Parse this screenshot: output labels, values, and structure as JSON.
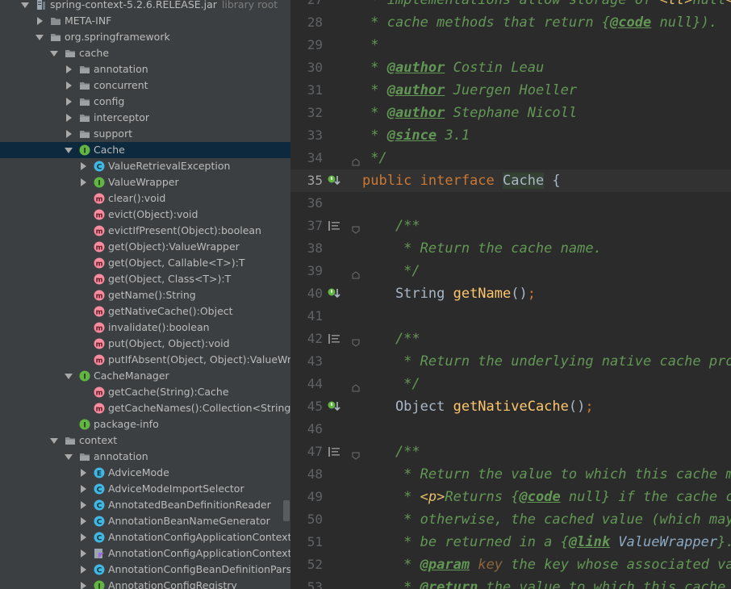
{
  "tree": {
    "rows": [
      {
        "label": "spring-context-5.2.6.RELEASE.jar",
        "hint": "library root",
        "depth": 0,
        "arrow": "open",
        "icon": "jar-icon"
      },
      {
        "label": "META-INF",
        "depth": 1,
        "arrow": "closed",
        "icon": "folder-icon"
      },
      {
        "label": "org.springframework",
        "depth": 1,
        "arrow": "open",
        "icon": "package-icon"
      },
      {
        "label": "cache",
        "depth": 2,
        "arrow": "open",
        "icon": "package-icon"
      },
      {
        "label": "annotation",
        "depth": 3,
        "arrow": "closed",
        "icon": "package-icon"
      },
      {
        "label": "concurrent",
        "depth": 3,
        "arrow": "closed",
        "icon": "package-icon"
      },
      {
        "label": "config",
        "depth": 3,
        "arrow": "closed",
        "icon": "package-icon"
      },
      {
        "label": "interceptor",
        "depth": 3,
        "arrow": "closed",
        "icon": "package-icon"
      },
      {
        "label": "support",
        "depth": 3,
        "arrow": "closed",
        "icon": "package-icon"
      },
      {
        "label": "Cache",
        "depth": 3,
        "arrow": "open",
        "icon": "interface-icon",
        "selected": true
      },
      {
        "label": "ValueRetrievalException",
        "depth": 4,
        "arrow": "closed",
        "icon": "class-icon"
      },
      {
        "label": "ValueWrapper",
        "depth": 4,
        "arrow": "closed",
        "icon": "interface-icon"
      },
      {
        "label": "clear():void",
        "depth": 4,
        "arrow": "none",
        "icon": "method-icon"
      },
      {
        "label": "evict(Object):void",
        "depth": 4,
        "arrow": "none",
        "icon": "method-icon"
      },
      {
        "label": "evictIfPresent(Object):boolean",
        "depth": 4,
        "arrow": "none",
        "icon": "method-icon"
      },
      {
        "label": "get(Object):ValueWrapper",
        "depth": 4,
        "arrow": "none",
        "icon": "method-icon"
      },
      {
        "label": "get(Object, Callable<T>):T",
        "depth": 4,
        "arrow": "none",
        "icon": "method-icon"
      },
      {
        "label": "get(Object, Class<T>):T",
        "depth": 4,
        "arrow": "none",
        "icon": "method-icon"
      },
      {
        "label": "getName():String",
        "depth": 4,
        "arrow": "none",
        "icon": "method-icon"
      },
      {
        "label": "getNativeCache():Object",
        "depth": 4,
        "arrow": "none",
        "icon": "method-icon"
      },
      {
        "label": "invalidate():boolean",
        "depth": 4,
        "arrow": "none",
        "icon": "method-icon"
      },
      {
        "label": "put(Object, Object):void",
        "depth": 4,
        "arrow": "none",
        "icon": "method-icon"
      },
      {
        "label": "putIfAbsent(Object, Object):ValueWrapper",
        "depth": 4,
        "arrow": "none",
        "icon": "method-icon"
      },
      {
        "label": "CacheManager",
        "depth": 3,
        "arrow": "open",
        "icon": "interface-icon"
      },
      {
        "label": "getCache(String):Cache",
        "depth": 4,
        "arrow": "none",
        "icon": "method-icon"
      },
      {
        "label": "getCacheNames():Collection<String>",
        "depth": 4,
        "arrow": "none",
        "icon": "method-icon"
      },
      {
        "label": "package-info",
        "depth": 3,
        "arrow": "none",
        "icon": "interface-icon"
      },
      {
        "label": "context",
        "depth": 2,
        "arrow": "open",
        "icon": "package-icon"
      },
      {
        "label": "annotation",
        "depth": 3,
        "arrow": "open",
        "icon": "package-icon"
      },
      {
        "label": "AdviceMode",
        "depth": 4,
        "arrow": "closed",
        "icon": "enum-icon"
      },
      {
        "label": "AdviceModeImportSelector",
        "depth": 4,
        "arrow": "closed",
        "icon": "class-icon"
      },
      {
        "label": "AnnotatedBeanDefinitionReader",
        "depth": 4,
        "arrow": "closed",
        "icon": "class-icon"
      },
      {
        "label": "AnnotationBeanNameGenerator",
        "depth": 4,
        "arrow": "closed",
        "icon": "class-icon"
      },
      {
        "label": "AnnotationConfigApplicationContext",
        "depth": 4,
        "arrow": "closed",
        "icon": "class-icon"
      },
      {
        "label": "AnnotationConfigApplicationContextExtensions",
        "depth": 4,
        "arrow": "closed",
        "icon": "kotlin-file-icon"
      },
      {
        "label": "AnnotationConfigBeanDefinitionParser",
        "depth": 4,
        "arrow": "closed",
        "icon": "class-icon"
      },
      {
        "label": "AnnotationConfigRegistry",
        "depth": 4,
        "arrow": "closed",
        "icon": "interface-icon"
      }
    ]
  },
  "editor": {
    "current_line": "35",
    "lines": [
      {
        "n": "27",
        "gutter": "",
        "segs": [
          {
            "t": " * implementations allow storage of ",
            "k": "c"
          },
          {
            "t": "<tt>",
            "k": "html"
          },
          {
            "t": "null",
            "k": "c"
          },
          {
            "t": "</tt>",
            "k": "html"
          }
        ]
      },
      {
        "n": "28",
        "gutter": "",
        "segs": [
          {
            "t": " * cache methods that return {",
            "k": "c"
          },
          {
            "t": "@code",
            "k": "tag"
          },
          {
            "t": " null}).",
            "k": "c"
          }
        ]
      },
      {
        "n": "29",
        "gutter": "",
        "segs": [
          {
            "t": " *",
            "k": "c"
          }
        ]
      },
      {
        "n": "30",
        "gutter": "",
        "segs": [
          {
            "t": " * ",
            "k": "c"
          },
          {
            "t": "@author",
            "k": "tag"
          },
          {
            "t": " Costin Leau",
            "k": "c"
          }
        ]
      },
      {
        "n": "31",
        "gutter": "",
        "segs": [
          {
            "t": " * ",
            "k": "c"
          },
          {
            "t": "@author",
            "k": "tag"
          },
          {
            "t": " Juergen Hoeller",
            "k": "c"
          }
        ]
      },
      {
        "n": "32",
        "gutter": "",
        "segs": [
          {
            "t": " * ",
            "k": "c"
          },
          {
            "t": "@author",
            "k": "tag"
          },
          {
            "t": " Stephane Nicoll",
            "k": "c"
          }
        ]
      },
      {
        "n": "33",
        "gutter": "",
        "segs": [
          {
            "t": " * ",
            "k": "c"
          },
          {
            "t": "@since",
            "k": "tag"
          },
          {
            "t": " 3.1",
            "k": "c"
          }
        ]
      },
      {
        "n": "34",
        "gutter": "fold-end",
        "segs": [
          {
            "t": " */",
            "k": "c"
          }
        ]
      },
      {
        "n": "35",
        "gutter": "implemented",
        "segs": [
          {
            "t": "public interface ",
            "k": "kw"
          },
          {
            "t": "Cache",
            "k": "ident"
          },
          {
            "t": " {",
            "k": ""
          }
        ]
      },
      {
        "n": "36",
        "gutter": "",
        "segs": []
      },
      {
        "n": "37",
        "gutter": "doc",
        "segs": [
          {
            "t": "    /**",
            "k": "c"
          }
        ]
      },
      {
        "n": "38",
        "gutter": "",
        "segs": [
          {
            "t": "     * Return the cache name.",
            "k": "c"
          }
        ]
      },
      {
        "n": "39",
        "gutter": "fold-end",
        "segs": [
          {
            "t": "     */",
            "k": "c"
          }
        ]
      },
      {
        "n": "40",
        "gutter": "implemented",
        "segs": [
          {
            "t": "    String ",
            "k": ""
          },
          {
            "t": "getName",
            "k": "fn"
          },
          {
            "t": "()",
            "k": ""
          },
          {
            "t": ";",
            "k": "kw"
          }
        ]
      },
      {
        "n": "41",
        "gutter": "",
        "segs": []
      },
      {
        "n": "42",
        "gutter": "doc",
        "segs": [
          {
            "t": "    /**",
            "k": "c"
          }
        ]
      },
      {
        "n": "43",
        "gutter": "",
        "segs": [
          {
            "t": "     * Return the underlying native cache provider.",
            "k": "c"
          }
        ]
      },
      {
        "n": "44",
        "gutter": "fold-end",
        "segs": [
          {
            "t": "     */",
            "k": "c"
          }
        ]
      },
      {
        "n": "45",
        "gutter": "implemented",
        "segs": [
          {
            "t": "    Object ",
            "k": ""
          },
          {
            "t": "getNativeCache",
            "k": "fn"
          },
          {
            "t": "()",
            "k": ""
          },
          {
            "t": ";",
            "k": "kw"
          }
        ]
      },
      {
        "n": "46",
        "gutter": "",
        "segs": []
      },
      {
        "n": "47",
        "gutter": "doc",
        "segs": [
          {
            "t": "    /**",
            "k": "c"
          }
        ]
      },
      {
        "n": "48",
        "gutter": "",
        "segs": [
          {
            "t": "     * Return the value to which this cache maps",
            "k": "c"
          }
        ]
      },
      {
        "n": "49",
        "gutter": "",
        "segs": [
          {
            "t": "     * ",
            "k": "c"
          },
          {
            "t": "<p>",
            "k": "html"
          },
          {
            "t": "Returns {",
            "k": "c"
          },
          {
            "t": "@code",
            "k": "tag"
          },
          {
            "t": " null} if the cache contains",
            "k": "c"
          }
        ]
      },
      {
        "n": "50",
        "gutter": "",
        "segs": [
          {
            "t": "     * otherwise, the cached value (which may be",
            "k": "c"
          }
        ]
      },
      {
        "n": "51",
        "gutter": "",
        "segs": [
          {
            "t": "     * be returned in a {",
            "k": "c"
          },
          {
            "t": "@link",
            "k": "tag"
          },
          {
            "t": " ValueWrapper",
            "k": "lnk"
          },
          {
            "t": "}.",
            "k": "c"
          }
        ]
      },
      {
        "n": "52",
        "gutter": "",
        "segs": [
          {
            "t": "     * ",
            "k": "c"
          },
          {
            "t": "@param",
            "k": "tag"
          },
          {
            "t": " ",
            "k": "c"
          },
          {
            "t": "key",
            "k": "prm"
          },
          {
            "t": " the key whose associated value",
            "k": "c"
          }
        ]
      },
      {
        "n": "53",
        "gutter": "",
        "segs": [
          {
            "t": "     * ",
            "k": "c"
          },
          {
            "t": "@return",
            "k": "tag"
          },
          {
            "t": " the value to which this cache maps",
            "k": "c"
          }
        ]
      }
    ]
  },
  "colors": {
    "tree_bg": "#3c3f41",
    "editor_bg": "#2b2b2b",
    "selection": "#0d293e",
    "comment": "#629755",
    "keyword": "#cc7832",
    "function": "#ffc66d",
    "text": "#a9b7c6"
  }
}
